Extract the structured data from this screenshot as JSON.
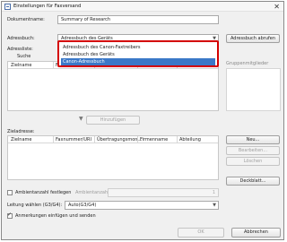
{
  "window": {
    "title": "Einstellungen für Faxversand",
    "close": "✕"
  },
  "document": {
    "label": "Dokumentname:",
    "value": "Summary of Research"
  },
  "address_book": {
    "label": "Adressbuch:",
    "current_value": "Adressbuch des Geräts",
    "retrieve_button": "Adressbuch abrufen",
    "options": [
      "Adressbuch des Canon-Faxtreibers",
      "Adressbuch des Geräts",
      "Canon-Adressbuch"
    ],
    "selected_option": "Canon-Adressbuch"
  },
  "address_list": {
    "label": "Adressliste:",
    "search_label": "Suche",
    "columns": [
      "Zielname",
      "Faxnummer/URI",
      "Übertragungsmon...",
      "Firmenname",
      "Abteilung"
    ]
  },
  "group_members_label": "Gruppenmitglieder",
  "add_button": "Hinzufügen",
  "target": {
    "label": "Zieladresse:",
    "columns": [
      "Zielname",
      "Faxnummer/URI",
      "Übertragungsmon...",
      "Firmenname",
      "Abteilung"
    ],
    "buttons": {
      "new": "Neu...",
      "edit": "Bearbeiten...",
      "delete": "Löschen",
      "cover": "Deckblatt..."
    }
  },
  "copies": {
    "checkbox_label": "Ambientanzahl festlegen",
    "count_label": "Ambientanzahl:",
    "count_value": "1",
    "checked": false
  },
  "line": {
    "label": "Leitung wählen (G3/G4):",
    "value": "Auto(G3/G4)"
  },
  "apply_comments": {
    "label": "Anmerkungen einfügen und senden",
    "checked": true
  },
  "footer": {
    "ok": "OK",
    "cancel": "Abbrechen"
  },
  "colors": {
    "highlight_border": "#d40000",
    "selection": "#3b78c8"
  }
}
